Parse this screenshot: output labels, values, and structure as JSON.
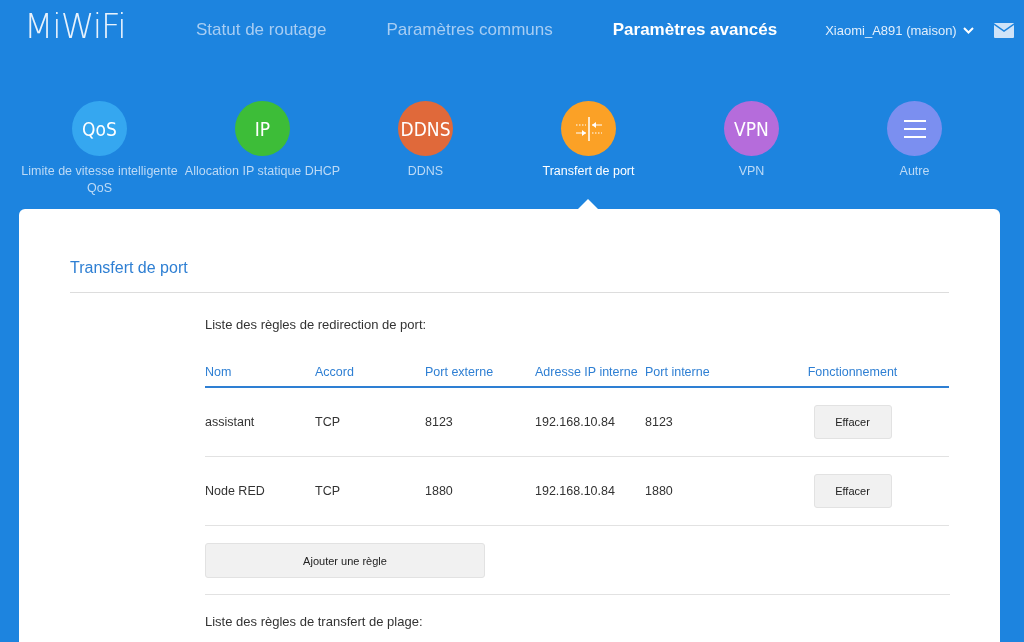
{
  "logo": "MiWiFi",
  "nav": [
    {
      "label": "Statut de routage",
      "selected": false
    },
    {
      "label": "Paramètres communs",
      "selected": false
    },
    {
      "label": "Paramètres avancés",
      "selected": true
    }
  ],
  "router": {
    "name": "Xiaomi_A891 (maison)"
  },
  "features": [
    {
      "kind": "text",
      "icon_text": "QoS",
      "label": "Limite de vitesse intelligente QoS",
      "color": "#35a7f0",
      "selected": false
    },
    {
      "kind": "text",
      "icon_text": "IP",
      "label": "Allocation IP statique DHCP",
      "color": "#3dbd38",
      "selected": false
    },
    {
      "kind": "text",
      "icon_text": "DDNS",
      "label": "DDNS",
      "color": "#e0693a",
      "selected": false
    },
    {
      "kind": "ports",
      "label": "Transfert de port",
      "color": "#fba126",
      "selected": true
    },
    {
      "kind": "text",
      "icon_text": "VPN",
      "label": "VPN",
      "color": "#b56cdb",
      "selected": false
    },
    {
      "kind": "menu",
      "label": "Autre",
      "color": "#7b8ff0",
      "selected": false
    }
  ],
  "panel": {
    "title": "Transfert de port",
    "list_title": "Liste des règles de redirection de port:",
    "columns": [
      "Nom",
      "Accord",
      "Port externe",
      "Adresse IP interne",
      "Port interne",
      "Fonctionnement"
    ],
    "rows": [
      {
        "cells": [
          "assistant",
          "TCP",
          "8123",
          "192.168.10.84",
          "8123"
        ],
        "action": "Effacer"
      },
      {
        "cells": [
          "Node RED",
          "TCP",
          "1880",
          "192.168.10.84",
          "1880"
        ],
        "action": "Effacer"
      }
    ],
    "add_button": "Ajouter une règle",
    "range_title": "Liste des règles de transfert de plage:"
  }
}
